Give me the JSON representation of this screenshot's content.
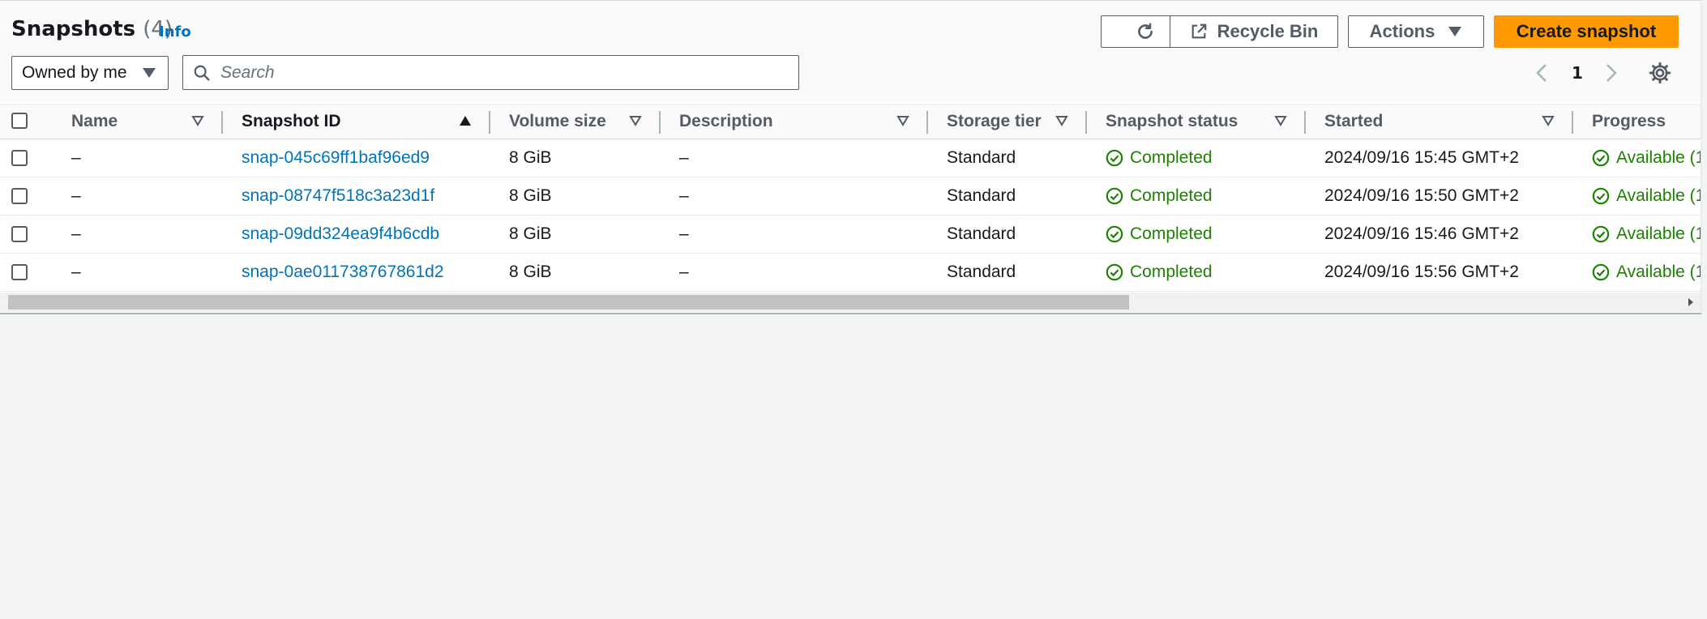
{
  "header": {
    "title": "Snapshots",
    "count": "(4)",
    "info_link": "Info"
  },
  "toolbar": {
    "refresh_icon": "refresh-icon",
    "recycle_bin_label": "Recycle Bin",
    "actions_label": "Actions",
    "create_label": "Create snapshot"
  },
  "filters": {
    "owner_value": "Owned by me",
    "search_placeholder": "Search"
  },
  "pagination": {
    "current_page": "1"
  },
  "table": {
    "columns": {
      "name": "Name",
      "snapshot_id": "Snapshot ID",
      "volume_size": "Volume size",
      "description": "Description",
      "storage_tier": "Storage tier",
      "snapshot_status": "Snapshot status",
      "started": "Started",
      "progress": "Progress"
    },
    "rows": [
      {
        "name": "–",
        "id": "snap-045c69ff1baf96ed9",
        "size": "8 GiB",
        "description": "–",
        "tier": "Standard",
        "status": "Completed",
        "started": "2024/09/16 15:45 GMT+2",
        "progress": "Available (1"
      },
      {
        "name": "–",
        "id": "snap-08747f518c3a23d1f",
        "size": "8 GiB",
        "description": "–",
        "tier": "Standard",
        "status": "Completed",
        "started": "2024/09/16 15:50 GMT+2",
        "progress": "Available (1"
      },
      {
        "name": "–",
        "id": "snap-09dd324ea9f4b6cdb",
        "size": "8 GiB",
        "description": "–",
        "tier": "Standard",
        "status": "Completed",
        "started": "2024/09/16 15:46 GMT+2",
        "progress": "Available (1"
      },
      {
        "name": "–",
        "id": "snap-0ae011738767861d2",
        "size": "8 GiB",
        "description": "–",
        "tier": "Standard",
        "status": "Completed",
        "started": "2024/09/16 15:56 GMT+2",
        "progress": "Available (1"
      }
    ]
  },
  "colors": {
    "primary": "#ff9900",
    "link": "#0073bb",
    "success": "#1d8102",
    "page_bg": "#f2f3f3"
  }
}
